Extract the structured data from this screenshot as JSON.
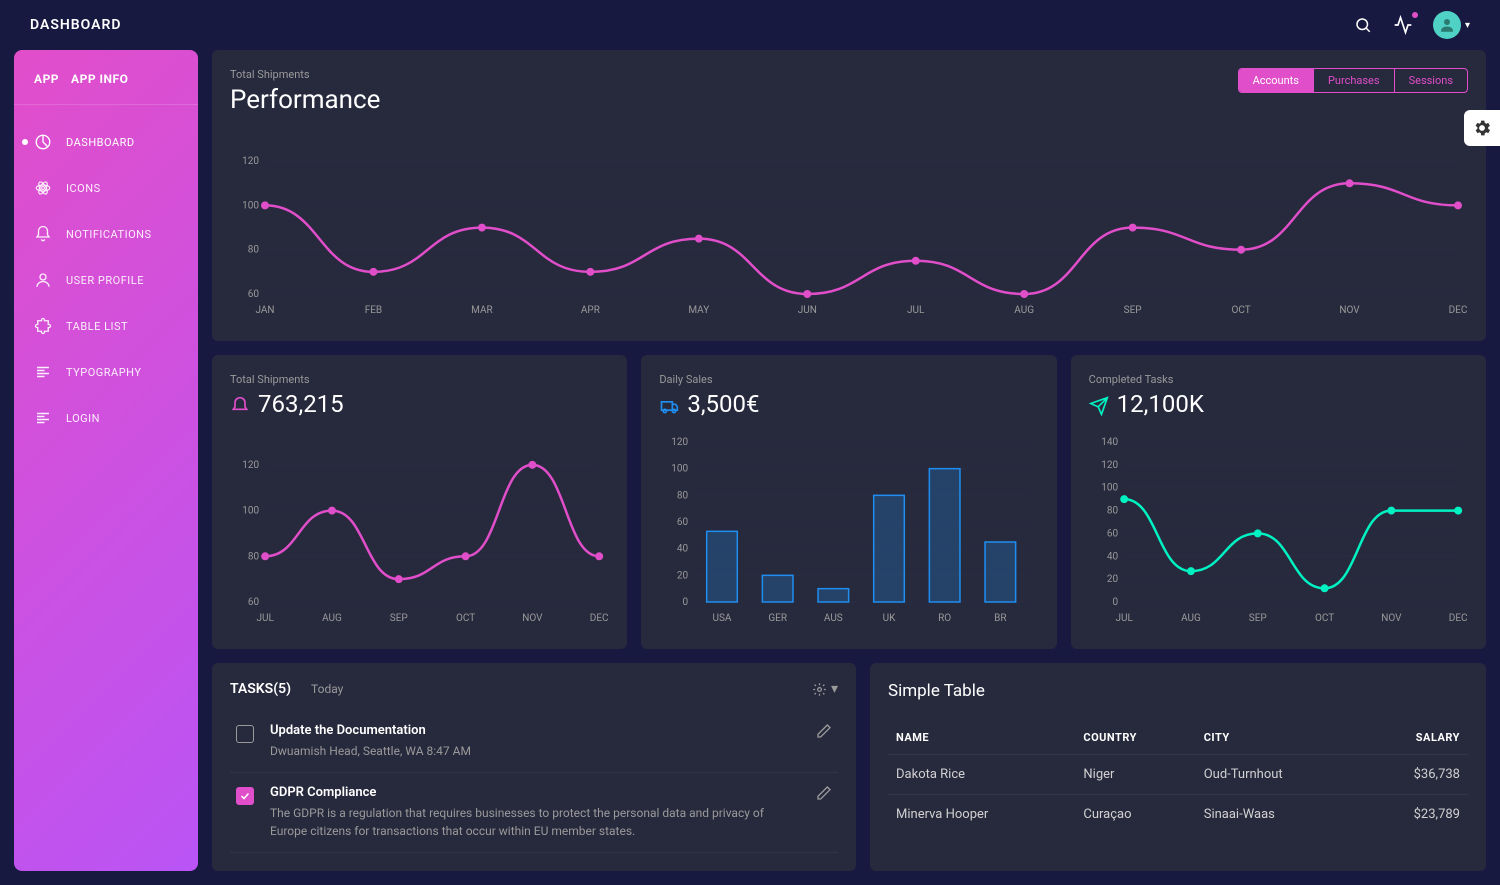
{
  "topbar": {
    "title": "DASHBOARD"
  },
  "sidebar": {
    "app_label": "APP",
    "app_info_label": "APP INFO",
    "items": [
      {
        "label": "DASHBOARD",
        "active": true
      },
      {
        "label": "ICONS"
      },
      {
        "label": "NOTIFICATIONS"
      },
      {
        "label": "USER PROFILE"
      },
      {
        "label": "TABLE LIST"
      },
      {
        "label": "TYPOGRAPHY"
      },
      {
        "label": "LOGIN"
      }
    ]
  },
  "performance": {
    "subtitle": "Total Shipments",
    "title": "Performance",
    "tabs": [
      "Accounts",
      "Purchases",
      "Sessions"
    ],
    "active_tab": 0
  },
  "mini_cards": {
    "shipments": {
      "subtitle": "Total Shipments",
      "value": "763,215"
    },
    "sales": {
      "subtitle": "Daily Sales",
      "value": "3,500€"
    },
    "completed": {
      "subtitle": "Completed Tasks",
      "value": "12,100K"
    }
  },
  "tasks": {
    "title": "TASKS(5)",
    "today": "Today",
    "items": [
      {
        "title": "Update the Documentation",
        "desc": "Dwuamish Head, Seattle, WA 8:47 AM",
        "checked": false
      },
      {
        "title": "GDPR Compliance",
        "desc": "The GDPR is a regulation that requires businesses to protect the personal data and privacy of Europe citizens for transactions that occur within EU member states.",
        "checked": true
      }
    ]
  },
  "table": {
    "title": "Simple Table",
    "headers": [
      "NAME",
      "COUNTRY",
      "CITY",
      "SALARY"
    ],
    "rows": [
      {
        "name": "Dakota Rice",
        "country": "Niger",
        "city": "Oud-Turnhout",
        "salary": "$36,738"
      },
      {
        "name": "Minerva Hooper",
        "country": "Curaçao",
        "city": "Sinaai-Waas",
        "salary": "$23,789"
      }
    ]
  },
  "chart_data": [
    {
      "id": "performance",
      "type": "line",
      "categories": [
        "JAN",
        "FEB",
        "MAR",
        "APR",
        "MAY",
        "JUN",
        "JUL",
        "AUG",
        "SEP",
        "OCT",
        "NOV",
        "DEC"
      ],
      "values": [
        100,
        70,
        90,
        70,
        85,
        60,
        75,
        60,
        90,
        80,
        110,
        100
      ],
      "ylim": [
        60,
        130
      ],
      "color": "#e14eca",
      "title": "Performance",
      "xlabel": "",
      "ylabel": ""
    },
    {
      "id": "shipments",
      "type": "line",
      "categories": [
        "JUL",
        "AUG",
        "SEP",
        "OCT",
        "NOV",
        "DEC"
      ],
      "values": [
        80,
        100,
        70,
        80,
        120,
        80
      ],
      "ylim": [
        60,
        130
      ],
      "color": "#e14eca",
      "title": "Total Shipments",
      "xlabel": "",
      "ylabel": ""
    },
    {
      "id": "sales",
      "type": "bar",
      "categories": [
        "USA",
        "GER",
        "AUS",
        "UK",
        "RO",
        "BR"
      ],
      "values": [
        53,
        20,
        10,
        80,
        100,
        45
      ],
      "ylim": [
        0,
        120
      ],
      "color": "#1f8ef1",
      "title": "Daily Sales",
      "xlabel": "",
      "ylabel": ""
    },
    {
      "id": "completed",
      "type": "line",
      "categories": [
        "JUL",
        "AUG",
        "SEP",
        "OCT",
        "NOV",
        "DEC"
      ],
      "values": [
        90,
        27,
        60,
        12,
        80,
        80
      ],
      "ylim": [
        0,
        140
      ],
      "color": "#00f2c3",
      "title": "Completed Tasks",
      "xlabel": "",
      "ylabel": ""
    }
  ]
}
